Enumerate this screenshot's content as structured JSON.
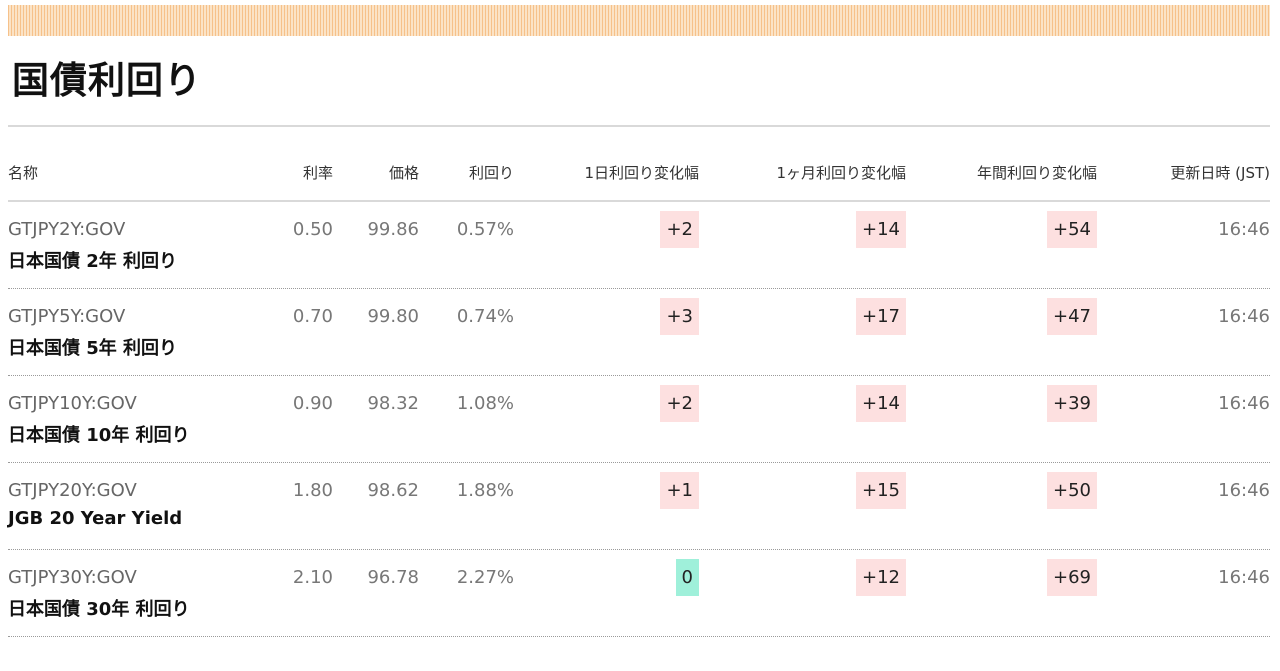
{
  "page": {
    "title": "国債利回り"
  },
  "table": {
    "headers": {
      "name": "名称",
      "coupon": "利率",
      "price": "価格",
      "yield": "利回り",
      "change_1d": "1日利回り変化幅",
      "change_1m": "1ヶ月利回り変化幅",
      "change_1y": "年間利回り変化幅",
      "updated": "更新日時 (JST)"
    },
    "rows": [
      {
        "code": "GTJPY2Y:GOV",
        "name": "日本国債 2年 利回り",
        "coupon": "0.50",
        "price": "99.86",
        "yield": "0.57%",
        "change_1d": "+2",
        "change_1m": "+14",
        "change_1y": "+54",
        "updated": "16:46"
      },
      {
        "code": "GTJPY5Y:GOV",
        "name": "日本国債 5年 利回り",
        "coupon": "0.70",
        "price": "99.80",
        "yield": "0.74%",
        "change_1d": "+3",
        "change_1m": "+17",
        "change_1y": "+47",
        "updated": "16:46"
      },
      {
        "code": "GTJPY10Y:GOV",
        "name": "日本国債 10年 利回り",
        "coupon": "0.90",
        "price": "98.32",
        "yield": "1.08%",
        "change_1d": "+2",
        "change_1m": "+14",
        "change_1y": "+39",
        "updated": "16:46"
      },
      {
        "code": "GTJPY20Y:GOV",
        "name": "JGB 20 Year Yield",
        "coupon": "1.80",
        "price": "98.62",
        "yield": "1.88%",
        "change_1d": "+1",
        "change_1m": "+15",
        "change_1y": "+50",
        "updated": "16:46"
      },
      {
        "code": "GTJPY30Y:GOV",
        "name": "日本国債 30年 利回り",
        "coupon": "2.10",
        "price": "96.78",
        "yield": "2.27%",
        "change_1d": "0",
        "change_1m": "+12",
        "change_1y": "+69",
        "updated": "16:46"
      }
    ]
  },
  "colors": {
    "positive_change_bg": "#fde0e0",
    "zero_change_bg": "#9ff0da",
    "top_band": "#f6c18a"
  }
}
